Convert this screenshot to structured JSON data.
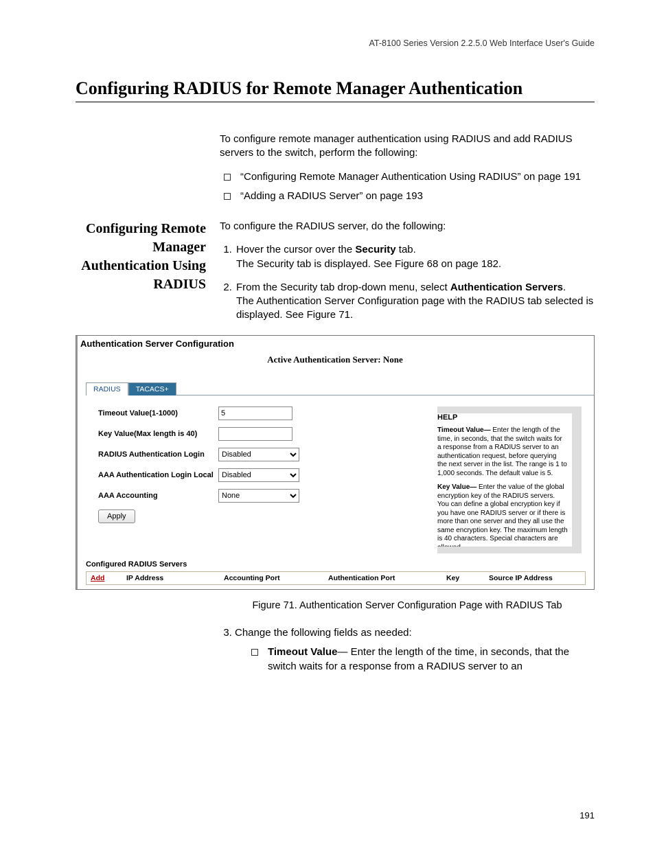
{
  "header": {
    "running_head": "AT-8100 Series Version 2.2.5.0 Web Interface User's Guide"
  },
  "title": "Configuring RADIUS for Remote Manager Authentication",
  "intro": "To configure remote manager authentication using RADIUS and add RADIUS servers to the switch, perform the following:",
  "xrefs": {
    "a": "“Configuring Remote Manager Authentication Using RADIUS” on page 191",
    "b": "“Adding a RADIUS Server” on page 193"
  },
  "side_heading": "Configuring Remote Manager Authentication Using RADIUS",
  "lead": "To configure the RADIUS server, do the following:",
  "step1_a_pre": "Hover the cursor over the ",
  "step1_a_bold": "Security",
  "step1_a_post": " tab.",
  "step1_b": "The Security tab is displayed. See Figure 68 on page 182.",
  "step2_a_pre": "From the Security tab drop-down menu, select ",
  "step2_a_bold": "Authentication Servers",
  "step2_a_post": ".",
  "step2_b": "The Authentication Server Configuration page with the RADIUS tab selected is displayed. See Figure 71.",
  "ui": {
    "panel_title": "Authentication Server Configuration",
    "active_server": "Active Authentication Server: None",
    "tabs": {
      "radius": "RADIUS",
      "tacacs": "TACACS+"
    },
    "fields": {
      "timeout_label": "Timeout Value(1-1000)",
      "timeout_value": "5",
      "key_label": "Key Value(Max length is 40)",
      "key_value": "",
      "ral_label": "RADIUS Authentication Login",
      "ral_value": "Disabled",
      "aall_label": "AAA Authentication Login Local",
      "aall_value": "Disabled",
      "aaa_acc_label": "AAA Accounting",
      "aaa_acc_value": "None",
      "apply": "Apply"
    },
    "help": {
      "title": "HELP",
      "p1_b": "Timeout Value— ",
      "p1": "Enter the length of the time, in seconds, that the switch waits for a response from a RADIUS server to an authentication request, before querying the next server in the list. The range is 1 to 1,000 seconds. The default value is 5.",
      "p2_b": "Key Value— ",
      "p2": "Enter the value of the global encryption key of the RADIUS servers. You can define a global encryption key if you have one RADIUS server or if there is more than one server and they all use the same encryption key. The maximum length is 40 characters. Special characters are allowed."
    },
    "cfg": {
      "title": "Configured RADIUS Servers",
      "add": "Add",
      "cols": {
        "ip": "IP Address",
        "acct": "Accounting Port",
        "auth": "Authentication Port",
        "key": "Key",
        "sip": "Source IP Address"
      }
    }
  },
  "figure_caption": "Figure 71. Authentication Server Configuration Page with RADIUS Tab",
  "step3": "Change the following fields as needed:",
  "field_note_bold": "Timeout Value",
  "field_note_rest": "— Enter the length of the time, in seconds, that the switch waits for a response from a RADIUS server to an",
  "page_number": "191"
}
